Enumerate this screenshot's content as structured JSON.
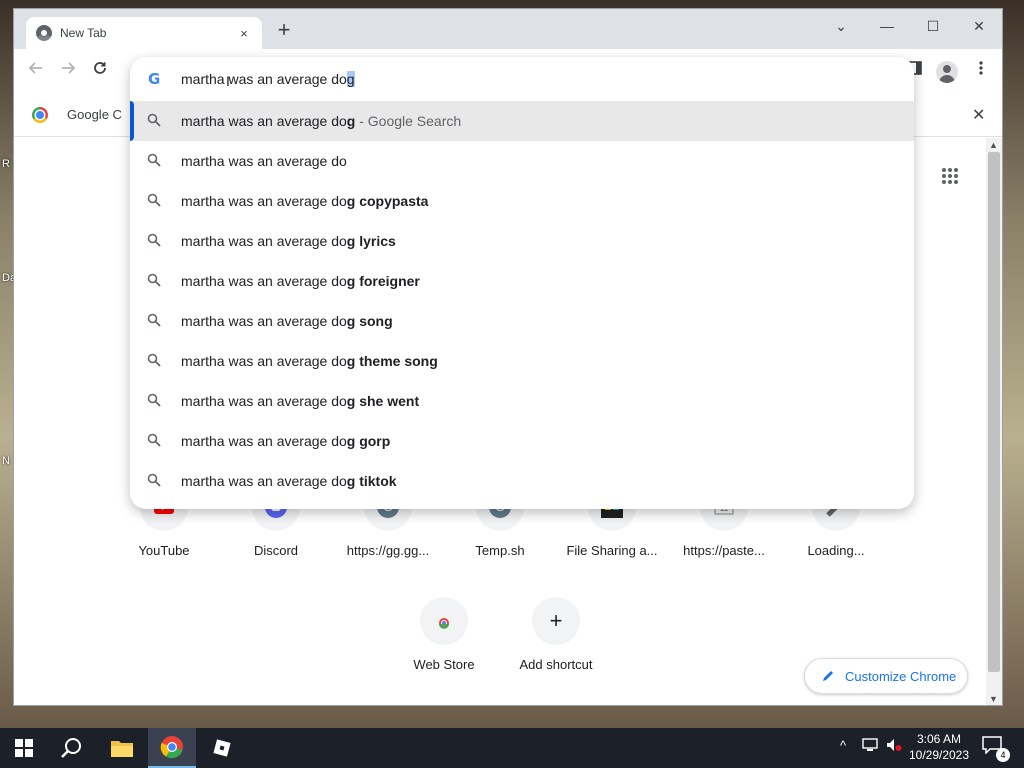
{
  "desktop": {
    "edge_labels": [
      "R",
      "Da",
      "N"
    ]
  },
  "tab": {
    "title": "New Tab",
    "close": "×",
    "new_tab": "+"
  },
  "window_controls": {
    "dropdown": "⌄",
    "minimize": "—",
    "maximize": "☐",
    "close": "✕"
  },
  "omnibox": {
    "typed": "martha was an average do",
    "autocomplete": "g",
    "suggestions": [
      {
        "prefix": "martha was an average do",
        "bold": "g",
        "suffix": " - Google Search"
      },
      {
        "prefix": "martha was an average do",
        "bold": "",
        "suffix": ""
      },
      {
        "prefix": "martha was an average do",
        "bold": "g copypasta",
        "suffix": ""
      },
      {
        "prefix": "martha was an average do",
        "bold": "g lyrics",
        "suffix": ""
      },
      {
        "prefix": "martha was an average do",
        "bold": "g foreigner",
        "suffix": ""
      },
      {
        "prefix": "martha was an average do",
        "bold": "g song",
        "suffix": ""
      },
      {
        "prefix": "martha was an average do",
        "bold": "g theme song",
        "suffix": ""
      },
      {
        "prefix": "martha was an average do",
        "bold": "g she went",
        "suffix": ""
      },
      {
        "prefix": "martha was an average do",
        "bold": "g gorp",
        "suffix": ""
      },
      {
        "prefix": "martha was an average do",
        "bold": "g tiktok",
        "suffix": ""
      }
    ]
  },
  "bookmark_bar": {
    "text": "Google C",
    "close": "✕"
  },
  "shortcuts": [
    {
      "label": "YouTube",
      "icon": "youtube-icon",
      "color": "#ff0000"
    },
    {
      "label": "Discord",
      "icon": "discord-icon",
      "color": "#5865f2"
    },
    {
      "label": "https://gg.gg...",
      "icon": "letter-g-icon",
      "color": "#5f7a8c"
    },
    {
      "label": "Temp.sh",
      "icon": "letter-g-icon",
      "color": "#5f7a8c"
    },
    {
      "label": "File Sharing a...",
      "icon": "colorful-square-icon",
      "color": "#222222"
    },
    {
      "label": "https://paste...",
      "icon": "paste-icon",
      "color": "#888888"
    },
    {
      "label": "Loading...",
      "icon": "loading-icon",
      "color": "#666666"
    }
  ],
  "shortcuts_row2": [
    {
      "label": "Web Store",
      "icon": "chrome-web-store-icon"
    },
    {
      "label": "Add shortcut",
      "icon": "plus-icon",
      "glyph": "+"
    }
  ],
  "customize": {
    "label": "Customize Chrome"
  },
  "taskbar": {
    "time": "3:06 AM",
    "date": "10/29/2023",
    "notifications": "4"
  }
}
